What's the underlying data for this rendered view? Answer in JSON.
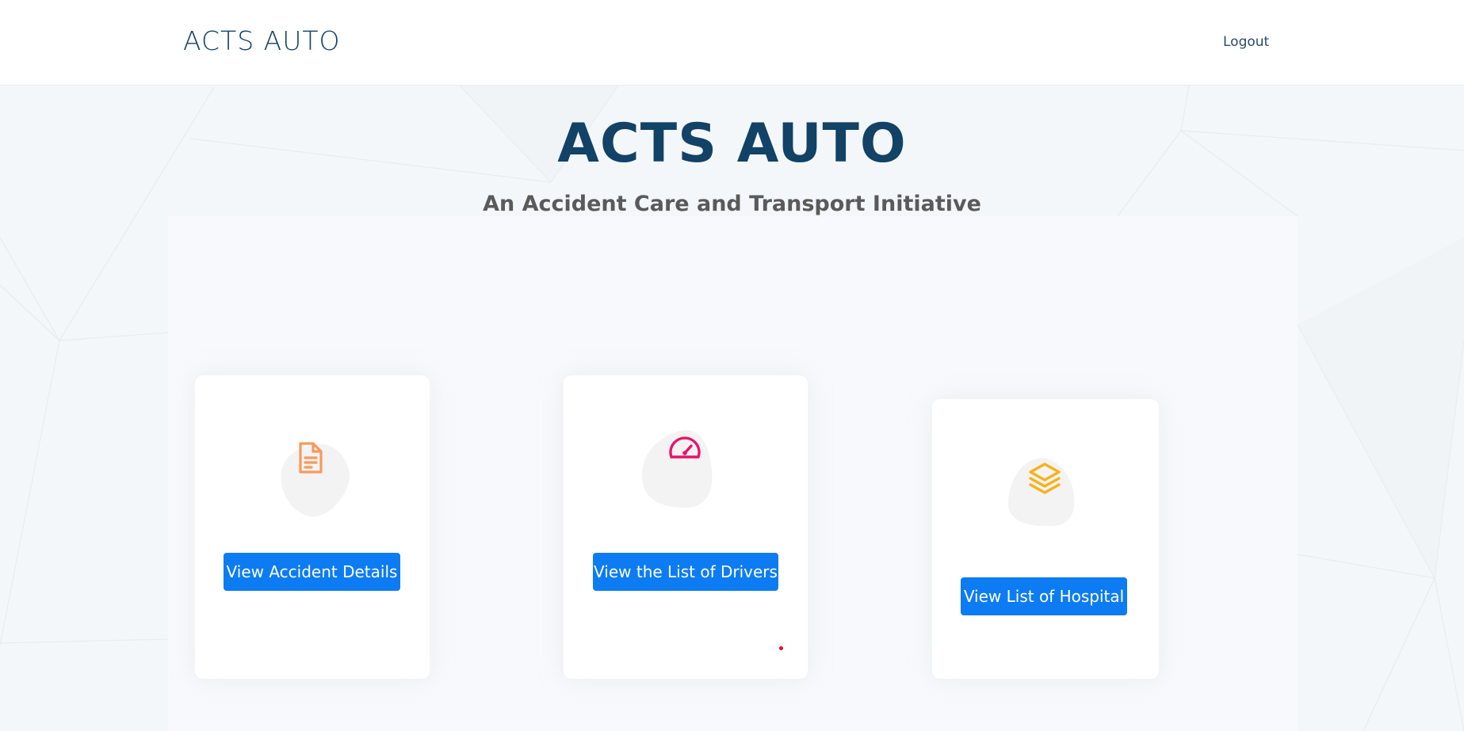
{
  "header": {
    "logo": "ACTS AUTO",
    "nav": {
      "logout_label": "Logout"
    }
  },
  "hero": {
    "title": "ACTS AUTO",
    "subtitle": "An Accident Care and Transport Initiative"
  },
  "cards": [
    {
      "icon": "document-icon",
      "icon_color": "#f79a5b",
      "button_label": "View Accident Details"
    },
    {
      "icon": "speedometer-icon",
      "icon_color": "#e8136b",
      "button_label": "View the List of Drivers"
    },
    {
      "icon": "layers-icon",
      "icon_color": "#f5b31b",
      "button_label": "View List of Hospital"
    }
  ],
  "colors": {
    "primary": "#124265",
    "button": "#0d7cf2",
    "blob": "#f3f3f3"
  }
}
